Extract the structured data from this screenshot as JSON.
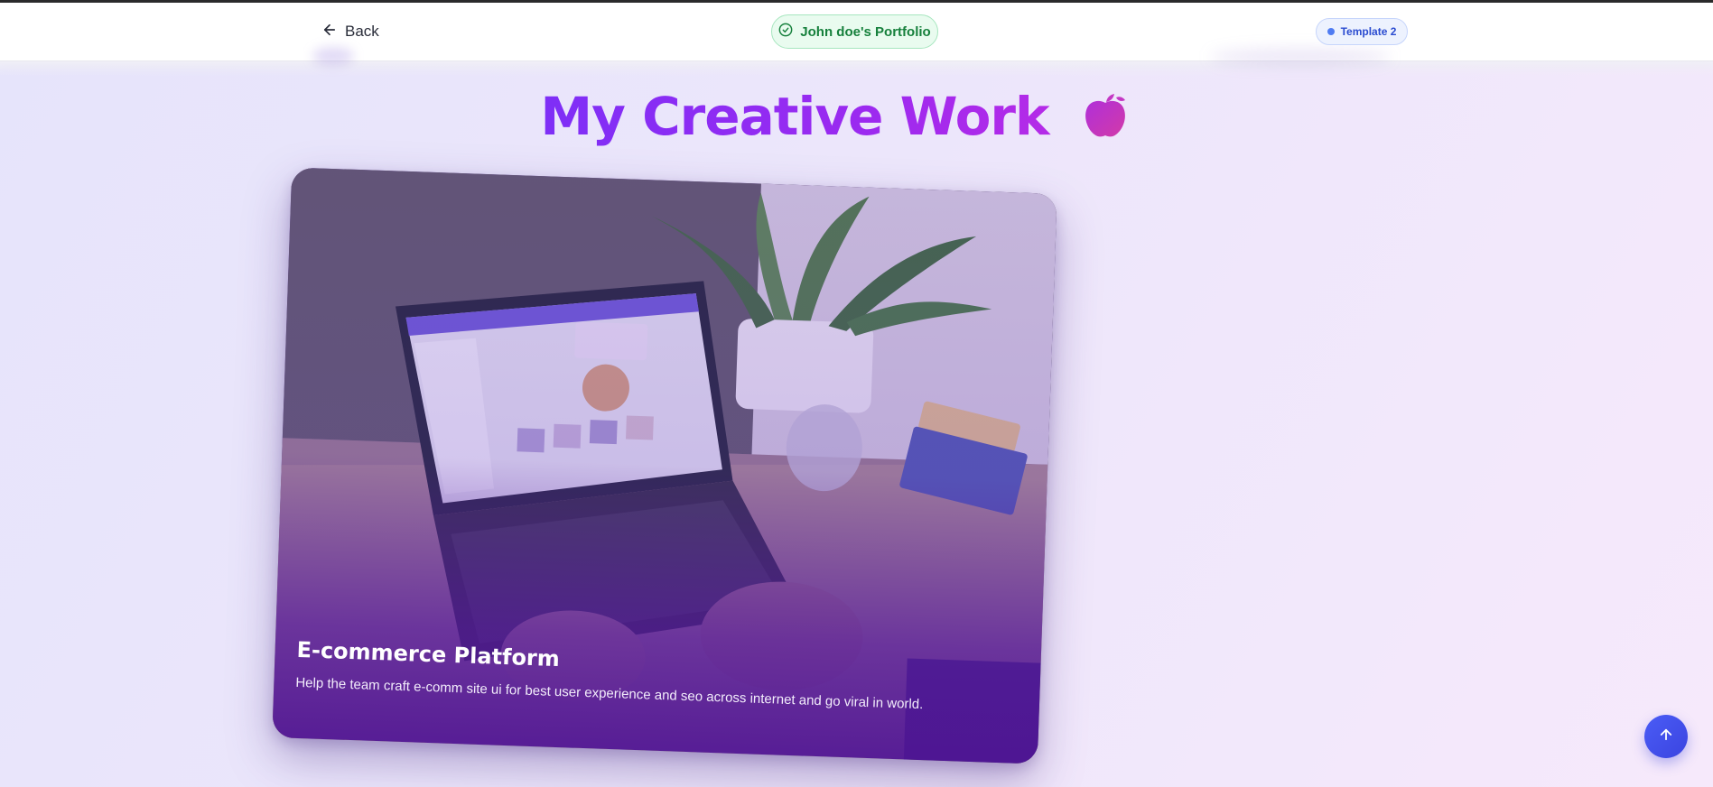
{
  "header": {
    "back_label": "Back",
    "portfolio_label": "John doe's Portfolio",
    "template_label": "Template 2"
  },
  "main": {
    "title": "My Creative Work",
    "title_emoji": "apple-emoji",
    "project": {
      "title": "E-commerce Platform",
      "description": "Help the team craft e-comm site ui for best user experience and seo across internet and go viral in world."
    }
  },
  "icons": {
    "back": "arrow-left-icon",
    "portfolio": "check-circle-icon",
    "template": "dot-icon",
    "scroll_top": "arrow-up-icon"
  },
  "colors": {
    "title_gradient_start": "#7b2ff7",
    "title_gradient_end": "#b92be6",
    "portfolio_text": "#16803c",
    "template_text": "#2a4bd0",
    "scroll_button": "#3b44e0"
  }
}
